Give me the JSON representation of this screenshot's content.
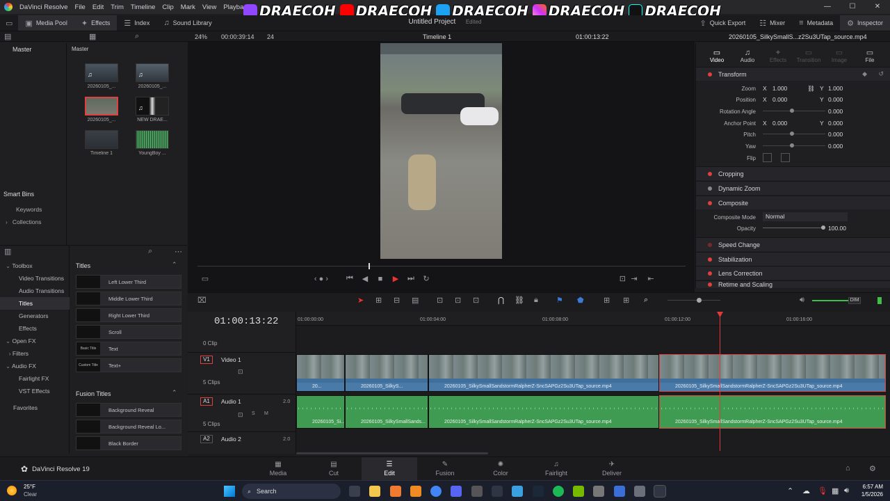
{
  "app": {
    "name": "DaVinci Resolve",
    "project": "Untitled Project",
    "edited": "Edited"
  },
  "menu": [
    "DaVinci Resolve",
    "File",
    "Edit",
    "Trim",
    "Timeline",
    "Clip",
    "Mark",
    "View",
    "Playback"
  ],
  "banner": {
    "handle": "DRAECOH"
  },
  "toolbar": {
    "media_pool": "Media Pool",
    "effects": "Effects",
    "index": "Index",
    "sound_library": "Sound Library",
    "quick_export": "Quick Export",
    "mixer": "Mixer",
    "metadata": "Metadata",
    "inspector": "Inspector"
  },
  "viewer": {
    "zoom": "24%",
    "timecode_left": "00:00:39:14",
    "fps": "24",
    "timeline_name": "Timeline 1",
    "timecode_right": "01:00:13:22",
    "source_file": "20260105_SilkySmallS...z2Su3UTap_source.mp4"
  },
  "media_pool": {
    "bin": "Master",
    "header": "Master",
    "smart_bins": "Smart Bins",
    "keywords": "Keywords",
    "collections": "Collections",
    "clips": [
      {
        "label": "20260105_..."
      },
      {
        "label": "20260105_..."
      },
      {
        "label": "20260105_..."
      },
      {
        "label": "NEW DRAE..."
      },
      {
        "label": "Timeline 1"
      },
      {
        "label": "YoungBoy ..."
      }
    ]
  },
  "effects": {
    "sidebar": [
      {
        "label": "Toolbox"
      },
      {
        "label": "Video Transitions"
      },
      {
        "label": "Audio Transitions"
      },
      {
        "label": "Titles"
      },
      {
        "label": "Generators"
      },
      {
        "label": "Effects"
      },
      {
        "label": "Open FX"
      },
      {
        "label": "Filters"
      },
      {
        "label": "Audio FX"
      },
      {
        "label": "Fairlight FX"
      },
      {
        "label": "VST Effects"
      },
      {
        "label": "Favorites"
      }
    ],
    "titles_header": "Titles",
    "titles": [
      "Left Lower Third",
      "Middle Lower Third",
      "Right Lower Third",
      "Scroll",
      "Text",
      "Text+"
    ],
    "title_thumbs": [
      "",
      "",
      "",
      "",
      "Basic Title",
      "Custom Title"
    ],
    "fusion_header": "Fusion Titles",
    "fusion_titles": [
      "Background Reveal",
      "Background Reveal Lo...",
      "Black Border"
    ]
  },
  "inspector": {
    "tabs": [
      "Video",
      "Audio",
      "Effects",
      "Transition",
      "Image",
      "File"
    ],
    "transform": "Transform",
    "zoom_label": "Zoom",
    "zoom_x": "1.000",
    "zoom_y": "1.000",
    "position_label": "Position",
    "pos_x": "0.000",
    "pos_y": "0.000",
    "rotation_label": "Rotation Angle",
    "rotation": "0.000",
    "anchor_label": "Anchor Point",
    "anchor_x": "0.000",
    "anchor_y": "0.000",
    "pitch_label": "Pitch",
    "pitch": "0.000",
    "yaw_label": "Yaw",
    "yaw": "0.000",
    "flip_label": "Flip",
    "x": "X",
    "y": "Y",
    "cropping": "Cropping",
    "dynamic_zoom": "Dynamic Zoom",
    "composite": "Composite",
    "composite_mode_label": "Composite Mode",
    "composite_mode": "Normal",
    "opacity_label": "Opacity",
    "opacity": "100.00",
    "speed_change": "Speed Change",
    "stabilization": "Stabilization",
    "lens_correction": "Lens Correction",
    "retime": "Retime and Scaling"
  },
  "timeline": {
    "timecode": "01:00:13:22",
    "ruler": [
      "01:00:00:00",
      "01:00:04:00",
      "01:00:08:00",
      "01:00:12:00",
      "01:00:16:00"
    ],
    "tracks": [
      {
        "id": "V1",
        "name": "Video 1",
        "clips": "5 Clips"
      },
      {
        "id": "A1",
        "name": "Audio 1",
        "clips": "5 Clips",
        "ch": "2.0"
      },
      {
        "id": "A2",
        "name": "Audio 2",
        "ch": "2.0"
      }
    ],
    "top_clips": "0 Clip",
    "dim": "DIM",
    "s": "S",
    "m": "M",
    "video_clips": [
      "20...",
      "20260105_SilkyS...",
      "20260105_SilkySmallSandstormRalpherZ-SncSAPGz2Su3UTap_source.mp4",
      "20260105_SilkySmallSandstormRalpherZ-SncSAPGz2Su3UTap_source.mp4"
    ],
    "audio_clips": [
      "20260105_Si...",
      "20260105_SilkySmallSands...",
      "20260105_SilkySmallSandstormRalpherZ-SncSAPGz2Su3UTap_source.mp4",
      "20260105_SilkySmallSandstormRalpherZ-SncSAPGz2Su3UTap_source.mp4"
    ]
  },
  "pages": {
    "brand": "DaVinci Resolve 19",
    "tabs": [
      "Media",
      "Cut",
      "Edit",
      "Fusion",
      "Color",
      "Fairlight",
      "Deliver"
    ],
    "active": "Edit"
  },
  "taskbar": {
    "temp": "25°F",
    "weather": "Clear",
    "search": "Search",
    "time": "6:57 AM",
    "date": "1/5/2026"
  }
}
